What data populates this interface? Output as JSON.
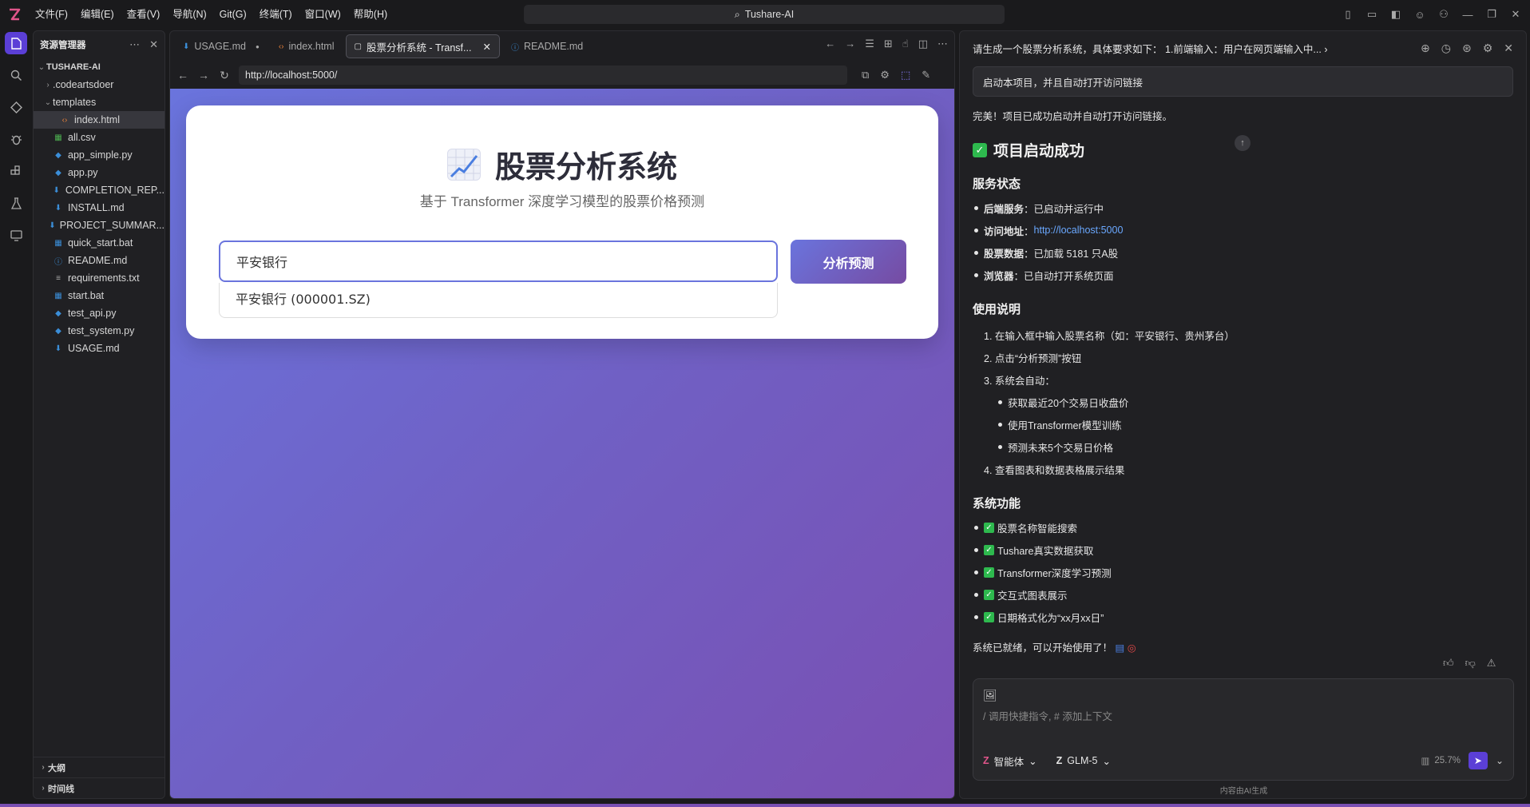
{
  "titlebar": {
    "menus": [
      "文件(F)",
      "编辑(E)",
      "查看(V)",
      "导航(N)",
      "Git(G)",
      "终端(T)",
      "窗口(W)",
      "帮助(H)"
    ],
    "search": "Tushare-AI"
  },
  "activity": [
    "explorer",
    "search",
    "source-control",
    "debug",
    "extensions",
    "testing",
    "remote"
  ],
  "explorer": {
    "title": "资源管理器",
    "root": "TUSHARE-AI",
    "items": [
      {
        "label": ".codeartsdoer",
        "kind": "folder",
        "indent": 1,
        "twisty": "›"
      },
      {
        "label": "templates",
        "kind": "folder",
        "indent": 1,
        "twisty": "⌄"
      },
      {
        "label": "index.html",
        "kind": "html",
        "indent": 2,
        "twisty": "",
        "selected": true
      },
      {
        "label": "all.csv",
        "kind": "csv",
        "indent": 1,
        "twisty": ""
      },
      {
        "label": "app_simple.py",
        "kind": "py",
        "indent": 1,
        "twisty": ""
      },
      {
        "label": "app.py",
        "kind": "py",
        "indent": 1,
        "twisty": ""
      },
      {
        "label": "COMPLETION_REP...",
        "kind": "md",
        "indent": 1,
        "twisty": ""
      },
      {
        "label": "INSTALL.md",
        "kind": "md",
        "indent": 1,
        "twisty": ""
      },
      {
        "label": "PROJECT_SUMMAR...",
        "kind": "md",
        "indent": 1,
        "twisty": ""
      },
      {
        "label": "quick_start.bat",
        "kind": "bat",
        "indent": 1,
        "twisty": ""
      },
      {
        "label": "README.md",
        "kind": "info",
        "indent": 1,
        "twisty": ""
      },
      {
        "label": "requirements.txt",
        "kind": "txt",
        "indent": 1,
        "twisty": ""
      },
      {
        "label": "start.bat",
        "kind": "bat",
        "indent": 1,
        "twisty": ""
      },
      {
        "label": "test_api.py",
        "kind": "py",
        "indent": 1,
        "twisty": ""
      },
      {
        "label": "test_system.py",
        "kind": "py",
        "indent": 1,
        "twisty": ""
      },
      {
        "label": "USAGE.md",
        "kind": "md",
        "indent": 1,
        "twisty": ""
      }
    ],
    "outline": "大纲",
    "timeline": "时间线"
  },
  "tabs": [
    {
      "label": "USAGE.md",
      "icon": "md",
      "modified": true
    },
    {
      "label": "index.html",
      "icon": "html"
    },
    {
      "label": "股票分析系统 - Transf...",
      "icon": "browser",
      "active": true
    },
    {
      "label": "README.md",
      "icon": "info"
    }
  ],
  "browser": {
    "url": "http://localhost:5000/"
  },
  "webpage": {
    "title": "股票分析系统",
    "subtitle": "基于 Transformer 深度学习模型的股票价格预测",
    "input_value": "平安银行",
    "button": "分析预测",
    "suggestion": "平安银行 (000001.SZ)"
  },
  "chat": {
    "title": "请生成一个股票分析系统，具体要求如下：  1.前端输入：用户在网页端输入中...",
    "user_message": "启动本项目，并且自动打开访问链接",
    "intro": "完美！项目已成功启动并自动打开访问链接。",
    "heading": "项目启动成功",
    "status_heading": "服务状态",
    "status": [
      {
        "k": "后端服务",
        "v": "已启动并运行中"
      },
      {
        "k": "访问地址",
        "v": "http://localhost:5000",
        "link": true
      },
      {
        "k": "股票数据",
        "v": "已加载 5181 只A股"
      },
      {
        "k": "浏览器",
        "v": "已自动打开系统页面"
      }
    ],
    "usage_heading": "使用说明",
    "steps": [
      "1. 在输入框中输入股票名称（如：平安银行、贵州茅台）",
      "2. 点击“分析预测”按钮",
      "3. 系统会自动：",
      "4. 查看图表和数据表格展示结果"
    ],
    "substeps": [
      "获取最近20个交易日收盘价",
      "使用Transformer模型训练",
      "预测未来5个交易日价格"
    ],
    "features_heading": "系统功能",
    "features": [
      "股票名称智能搜索",
      "Tushare真实数据获取",
      "Transformer深度学习预测",
      "交互式图表展示",
      "日期格式化为“xx月xx日”"
    ],
    "ready": "系统已就绪，可以开始使用了！",
    "input_placeholder": "/ 调用快捷指令, # 添加上下文",
    "agent": "智能体",
    "model": "GLM-5",
    "context_pct": "25.7%",
    "footer": "内容由AI生成"
  }
}
